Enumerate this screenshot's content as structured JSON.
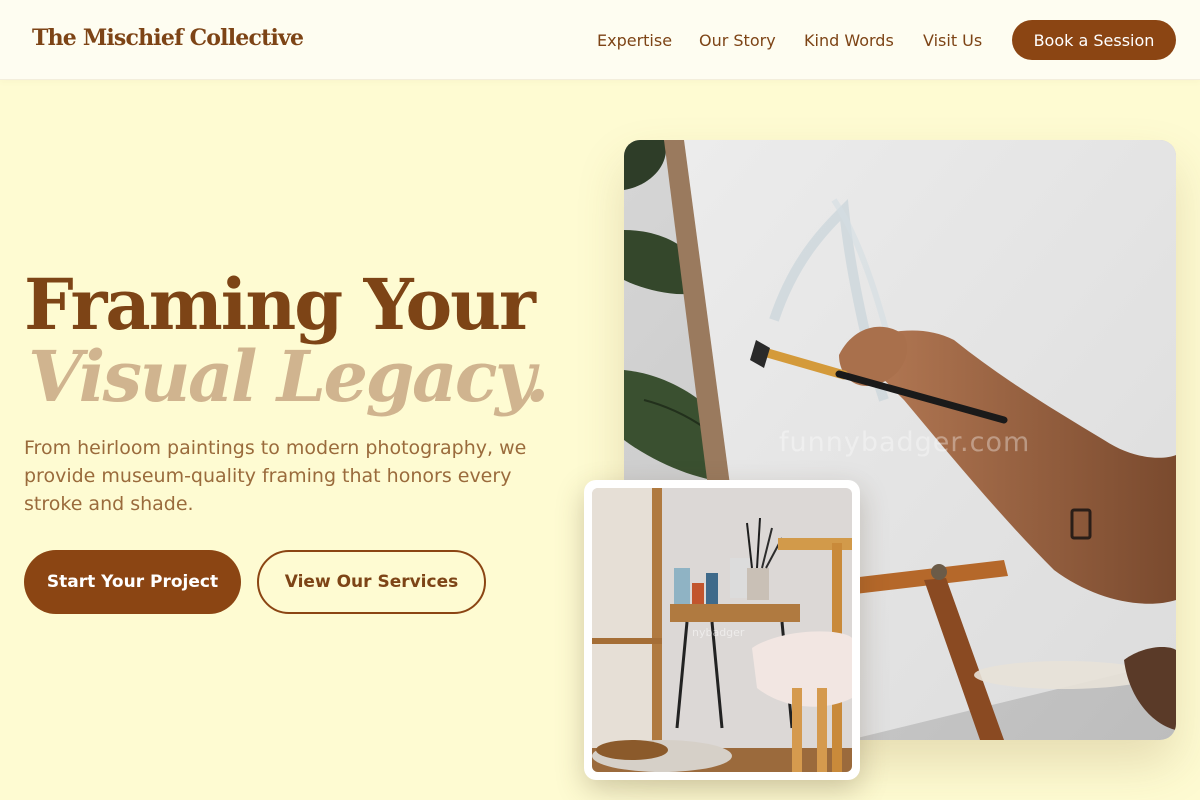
{
  "header": {
    "logo": "The Mischief Collective",
    "nav": [
      "Expertise",
      "Our Story",
      "Kind Words",
      "Visit Us"
    ],
    "cta": "Book a Session"
  },
  "hero": {
    "title_line1": "Framing Your",
    "title_line2": "Visual Legacy.",
    "description": "From heirloom paintings to modern photography, we provide museum-quality framing that honors every stroke and shade.",
    "primary_button": "Start Your Project",
    "secondary_button": "View Our Services"
  },
  "images": {
    "main_watermark": "funnybadger.com",
    "inset_watermark": "nybadger"
  },
  "colors": {
    "background": "#fefbd2",
    "primary": "#8b4513",
    "heading": "#7d4416",
    "heading_accent": "#d0b48f",
    "body_text": "#9a6b3c"
  }
}
